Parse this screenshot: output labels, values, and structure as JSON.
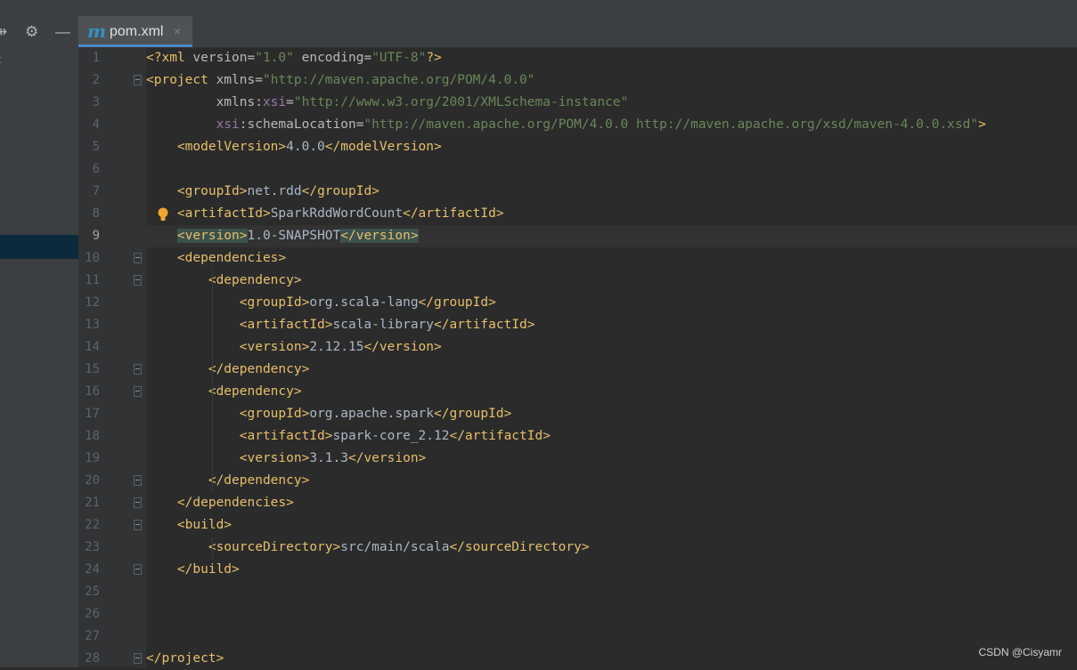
{
  "left_panel": {
    "partial_text": "t",
    "icons": [
      "split-arrows-icon",
      "gear-icon",
      "minimize-icon"
    ]
  },
  "tab": {
    "icon_letter": "m",
    "label": "pom.xml",
    "close_glyph": "×"
  },
  "editor": {
    "current_line": 9,
    "lines": [
      {
        "n": "1",
        "tokens": [
          [
            "tag",
            "<?xml "
          ],
          [
            "attr",
            "version="
          ],
          [
            "val",
            "\"1.0\""
          ],
          [
            "attr",
            " encoding="
          ],
          [
            "val",
            "\"UTF-8\""
          ],
          [
            "tag",
            "?>"
          ]
        ]
      },
      {
        "n": "2",
        "fold": true,
        "tokens": [
          [
            "tag",
            "<project "
          ],
          [
            "attr",
            "xmlns="
          ],
          [
            "val",
            "\"http://maven.apache.org/POM/4.0.0\""
          ]
        ]
      },
      {
        "n": "3",
        "tokens": [
          [
            "attr",
            "         xmlns:"
          ],
          [
            "ns",
            "xsi"
          ],
          [
            "attr",
            "="
          ],
          [
            "val",
            "\"http://www.w3.org/2001/XMLSchema-instance\""
          ]
        ]
      },
      {
        "n": "4",
        "tokens": [
          [
            "ns",
            "         xsi"
          ],
          [
            "attr",
            ":schemaLocation="
          ],
          [
            "val",
            "\"http://maven.apache.org/POM/4.0.0 http://maven.apache.org/xsd/maven-4.0.0.xsd\""
          ],
          [
            "tag",
            ">"
          ]
        ]
      },
      {
        "n": "5",
        "tokens": [
          [
            "tag",
            "    <modelVersion>"
          ],
          [
            "txt",
            "4.0.0"
          ],
          [
            "tag",
            "</modelVersion>"
          ]
        ]
      },
      {
        "n": "6",
        "tokens": []
      },
      {
        "n": "7",
        "tokens": [
          [
            "tag",
            "    <groupId>"
          ],
          [
            "txt",
            "net.rdd"
          ],
          [
            "tag",
            "</groupId>"
          ]
        ]
      },
      {
        "n": "8",
        "bulb": true,
        "tokens": [
          [
            "tag",
            "    <artifactId>"
          ],
          [
            "txt",
            "SparkRddWordCount"
          ],
          [
            "tag",
            "</artifactId>"
          ]
        ]
      },
      {
        "n": "9",
        "tokens": [
          [
            "txt",
            "    "
          ],
          [
            "tag-hl",
            "<version>"
          ],
          [
            "txt",
            "1.0-SNAPSHOT"
          ],
          [
            "tag-hl",
            "</version>"
          ]
        ]
      },
      {
        "n": "10",
        "fold": true,
        "tokens": [
          [
            "tag",
            "    <dependencies>"
          ]
        ]
      },
      {
        "n": "11",
        "fold": true,
        "tokens": [
          [
            "tag",
            "        <dependency>"
          ]
        ]
      },
      {
        "n": "12",
        "tokens": [
          [
            "tag",
            "            <groupId>"
          ],
          [
            "txt",
            "org.scala-lang"
          ],
          [
            "tag",
            "</groupId>"
          ]
        ]
      },
      {
        "n": "13",
        "tokens": [
          [
            "tag",
            "            <artifactId>"
          ],
          [
            "txt",
            "scala-library"
          ],
          [
            "tag",
            "</artifactId>"
          ]
        ]
      },
      {
        "n": "14",
        "tokens": [
          [
            "tag",
            "            <version>"
          ],
          [
            "txt",
            "2.12.15"
          ],
          [
            "tag",
            "</version>"
          ]
        ]
      },
      {
        "n": "15",
        "fold": true,
        "tokens": [
          [
            "tag",
            "        </dependency>"
          ]
        ]
      },
      {
        "n": "16",
        "fold": true,
        "tokens": [
          [
            "tag",
            "        <dependency>"
          ]
        ]
      },
      {
        "n": "17",
        "tokens": [
          [
            "tag",
            "            <groupId>"
          ],
          [
            "txt",
            "org.apache.spark"
          ],
          [
            "tag",
            "</groupId>"
          ]
        ]
      },
      {
        "n": "18",
        "tokens": [
          [
            "tag",
            "            <artifactId>"
          ],
          [
            "txt",
            "spark-core_2.12"
          ],
          [
            "tag",
            "</artifactId>"
          ]
        ]
      },
      {
        "n": "19",
        "tokens": [
          [
            "tag",
            "            <version>"
          ],
          [
            "txt",
            "3.1.3"
          ],
          [
            "tag",
            "</version>"
          ]
        ]
      },
      {
        "n": "20",
        "fold": true,
        "tokens": [
          [
            "tag",
            "        </dependency>"
          ]
        ]
      },
      {
        "n": "21",
        "fold": true,
        "tokens": [
          [
            "tag",
            "    </dependencies>"
          ]
        ]
      },
      {
        "n": "22",
        "fold": true,
        "tokens": [
          [
            "tag",
            "    <build>"
          ]
        ]
      },
      {
        "n": "23",
        "tokens": [
          [
            "tag",
            "        <sourceDirectory>"
          ],
          [
            "txt",
            "src/main/scala"
          ],
          [
            "tag",
            "</sourceDirectory>"
          ]
        ]
      },
      {
        "n": "24",
        "fold": true,
        "tokens": [
          [
            "tag",
            "    </build>"
          ]
        ]
      },
      {
        "n": "25",
        "tokens": []
      },
      {
        "n": "26",
        "tokens": []
      },
      {
        "n": "27",
        "tokens": []
      },
      {
        "n": "28",
        "fold": true,
        "tokens": [
          [
            "tag",
            "</project>"
          ]
        ]
      }
    ]
  },
  "watermark": "CSDN @Cisyamr",
  "colors": {
    "background": "#2b2b2b",
    "tag": "#e8bf6a",
    "attribute_value": "#6a8759",
    "namespace": "#9876aa",
    "text": "#a9b7c6",
    "current_line": "#323232",
    "matched_tag_highlight": "#3b514d"
  }
}
